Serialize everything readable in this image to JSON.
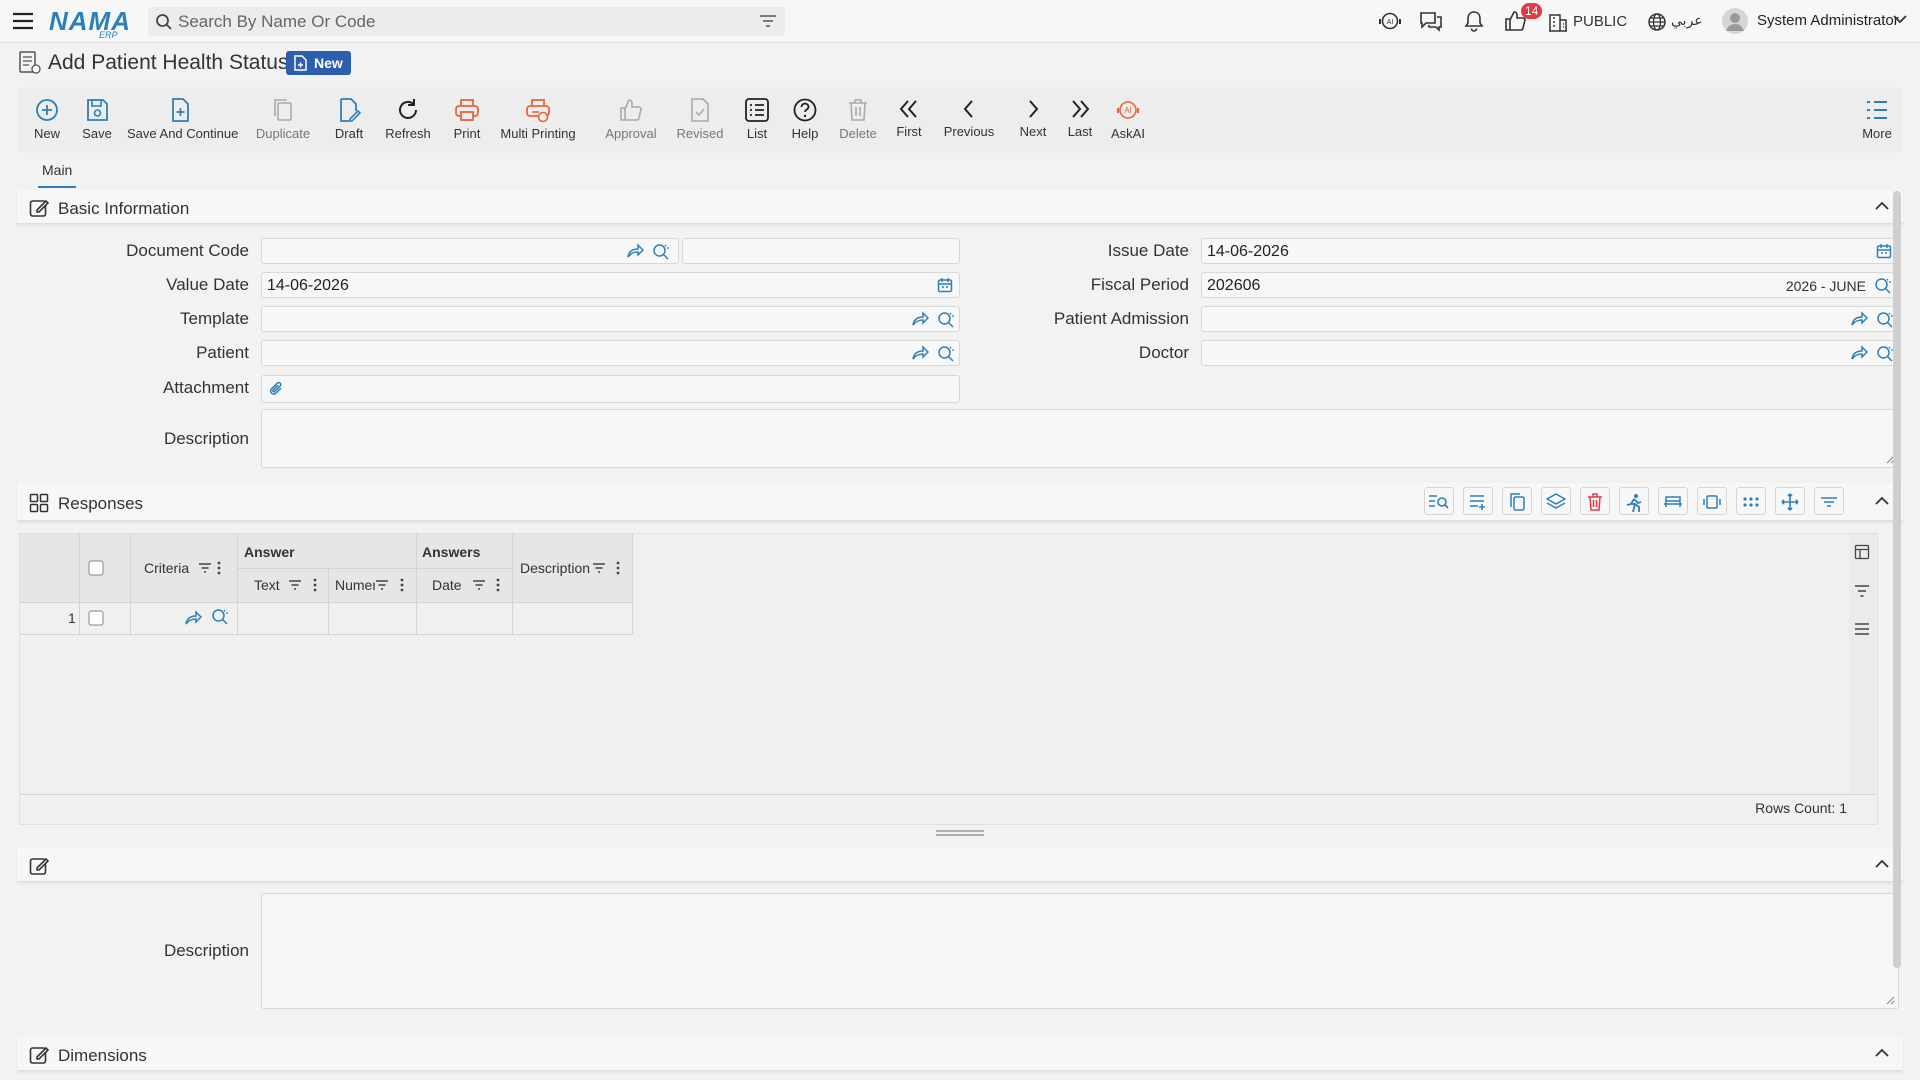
{
  "header": {
    "logo_text": "NAMA",
    "logo_sub": "ERP",
    "search_placeholder": "Search By Name Or Code",
    "notification_count": "14",
    "branch_label": "PUBLIC",
    "language_label": "عربي",
    "user_name": "System Administrator"
  },
  "page": {
    "title": "Add Patient Health Status",
    "status_badge": "New"
  },
  "toolbar": {
    "items": [
      {
        "label": "New"
      },
      {
        "label": "Save"
      },
      {
        "label": "Save And Continue"
      },
      {
        "label": "Duplicate"
      },
      {
        "label": "Draft"
      },
      {
        "label": "Refresh"
      },
      {
        "label": "Print"
      },
      {
        "label": "Multi Printing"
      },
      {
        "label": "Approval"
      },
      {
        "label": "Revised"
      },
      {
        "label": "List"
      },
      {
        "label": "Help"
      },
      {
        "label": "Delete"
      },
      {
        "label": "First"
      },
      {
        "label": "Previous"
      },
      {
        "label": "Next"
      },
      {
        "label": "Last"
      },
      {
        "label": "AskAI"
      },
      {
        "label": "More"
      }
    ]
  },
  "tabs": [
    {
      "label": "Main"
    }
  ],
  "basic_info": {
    "title": "Basic Information",
    "document_code_label": "Document Code",
    "value_date_label": "Value Date",
    "value_date": "14-06-2026",
    "template_label": "Template",
    "patient_label": "Patient",
    "attachment_label": "Attachment",
    "description_label": "Description",
    "issue_date_label": "Issue Date",
    "issue_date": "14-06-2026",
    "fiscal_period_label": "Fiscal Period",
    "fiscal_period": "202606",
    "fiscal_period_tag": "2026 - JUNE",
    "patient_admission_label": "Patient Admission",
    "doctor_label": "Doctor"
  },
  "responses": {
    "title": "Responses",
    "columns": {
      "criteria": "Criteria",
      "answer_group": "Answer",
      "answers_group": "Answers",
      "text": "Text",
      "numeric": "Numeri",
      "date": "Date",
      "description": "Description"
    },
    "rows": [
      {
        "index": "1"
      }
    ],
    "rows_count": "Rows Count: 1"
  },
  "bottom_section": {
    "description_label": "Description"
  },
  "dimensions": {
    "title": "Dimensions"
  },
  "colors": {
    "accent": "#2d7fb9",
    "badge": "#2d5fae",
    "danger": "#e63946",
    "print": "#e8643c"
  }
}
